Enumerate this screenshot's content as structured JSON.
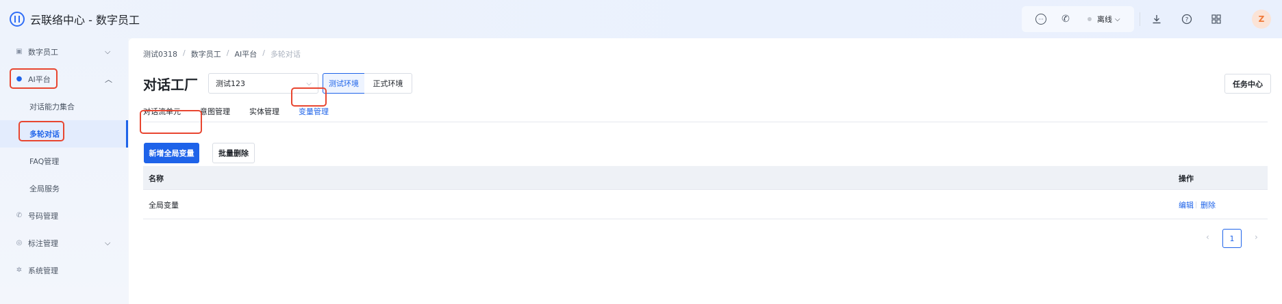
{
  "header": {
    "app_title": "云联络中心 - 数字员工",
    "logo_icon": "headset-logo-icon",
    "status": "离线",
    "icons": [
      "chat-icon",
      "phone-icon",
      "download-icon",
      "help-icon",
      "apps-grid-icon"
    ],
    "avatar_initial": "Z"
  },
  "sidebar": {
    "items": [
      {
        "label": "数字员工",
        "icon": "robot-icon",
        "chevron": "down"
      },
      {
        "label": "AI平台",
        "icon": "ai-icon",
        "chevron": "up"
      },
      {
        "label": "号码管理",
        "icon": "phone-icon"
      },
      {
        "label": "标注管理",
        "icon": "tag-icon",
        "chevron": "down"
      },
      {
        "label": "系统管理",
        "icon": "gear-icon"
      }
    ],
    "sub_items": [
      {
        "label": "对话能力集合"
      },
      {
        "label": "多轮对话",
        "active": true
      },
      {
        "label": "FAQ管理"
      },
      {
        "label": "全局服务"
      }
    ]
  },
  "breadcrumb": [
    "测试0318",
    "数字员工",
    "AI平台",
    "多轮对话"
  ],
  "page": {
    "title": "对话工厂",
    "select_value": "测试123",
    "env_tabs": [
      "测试环境",
      "正式环境"
    ],
    "task_center": "任务中心",
    "tabs": [
      "对话流单元",
      "意图管理",
      "实体管理",
      "变量管理"
    ],
    "active_tab": "变量管理",
    "add_button": "新增全局变量",
    "batch_delete_button": "批量删除"
  },
  "table": {
    "columns": [
      "名称",
      "操作"
    ],
    "rows": [
      {
        "name": "全局变量",
        "actions": [
          "编辑",
          "删除"
        ]
      }
    ]
  },
  "pagination": {
    "current_page": "1",
    "prev": "‹",
    "next": "›"
  },
  "colors": {
    "primary": "#1e63e9",
    "highlight_box": "#e8452f"
  }
}
